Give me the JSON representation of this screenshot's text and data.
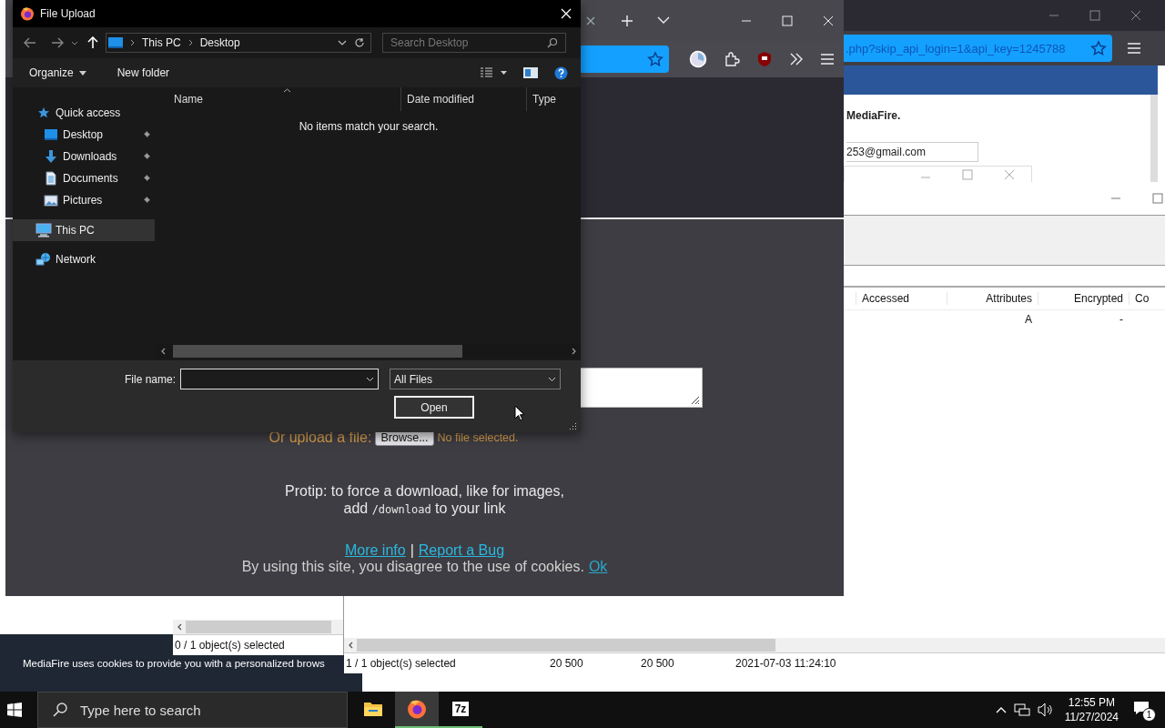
{
  "background_browser": {
    "url": ".php?skip_api_login=1&api_key=1245788",
    "heading": "MediaFire.",
    "email": "253@gmail.com"
  },
  "cookie_banner": {
    "text": "MediaFire uses cookies to provide you with a personalized brows"
  },
  "archive_window": {
    "columns": [
      "Accessed",
      "Attributes",
      "Encrypted",
      "Co"
    ],
    "rows": [
      {
        "attributes": "A",
        "encrypted": "-"
      }
    ],
    "left_status": "0 / 1 object(s) selected",
    "status": [
      "1 / 1 object(s) selected",
      "20 500",
      "20 500",
      "2021-07-03 11:24:10"
    ]
  },
  "browser": {
    "upload_label": "Or upload a file:",
    "browse_button": "Browse...",
    "file_status": "No file selected.",
    "protip": {
      "line_1": "Protip: to force a download, like for images,",
      "line_2_start": "add",
      "code": "/download",
      "line_2_end": "to your link"
    },
    "links": [
      "More info",
      "Report a Bug"
    ],
    "link_separator": "|",
    "cookie_notice": "By using this site, you disagree to the use of cookies.",
    "cookie_ok": "Ok"
  },
  "file_dialog": {
    "title": "File Upload",
    "breadcrumb": [
      "This PC",
      "Desktop"
    ],
    "search_placeholder": "Search Desktop",
    "toolbar": [
      "Organize",
      "New folder"
    ],
    "sidebar": [
      {
        "label": "Quick access",
        "kind": "star",
        "pinned": false,
        "selected": false,
        "children": [
          {
            "label": "Desktop",
            "kind": "desktop",
            "pinned": true,
            "selected": false
          },
          {
            "label": "Downloads",
            "kind": "download",
            "pinned": true,
            "selected": false
          },
          {
            "label": "Documents",
            "kind": "document",
            "pinned": true,
            "selected": false
          },
          {
            "label": "Pictures",
            "kind": "picture",
            "pinned": true,
            "selected": false
          }
        ]
      },
      {
        "label": "This PC",
        "kind": "pc",
        "pinned": false,
        "selected": true
      },
      {
        "label": "Network",
        "kind": "network",
        "pinned": false,
        "selected": false
      }
    ],
    "columns": [
      "Name",
      "Date modified",
      "Type"
    ],
    "empty_message": "No items match your search.",
    "file_name_label": "File name:",
    "file_type": "All Files",
    "open_button": "Open"
  },
  "taskbar": {
    "search_placeholder": "Type here to search",
    "apps": [
      {
        "kind": "explorer",
        "selected": false,
        "running": false
      },
      {
        "kind": "firefox",
        "selected": true,
        "running": true
      },
      {
        "kind": "archiver",
        "label": "7z",
        "selected": false,
        "running": true
      }
    ],
    "time": "12:55 PM",
    "date": "11/27/2024",
    "notification_count": "1"
  }
}
